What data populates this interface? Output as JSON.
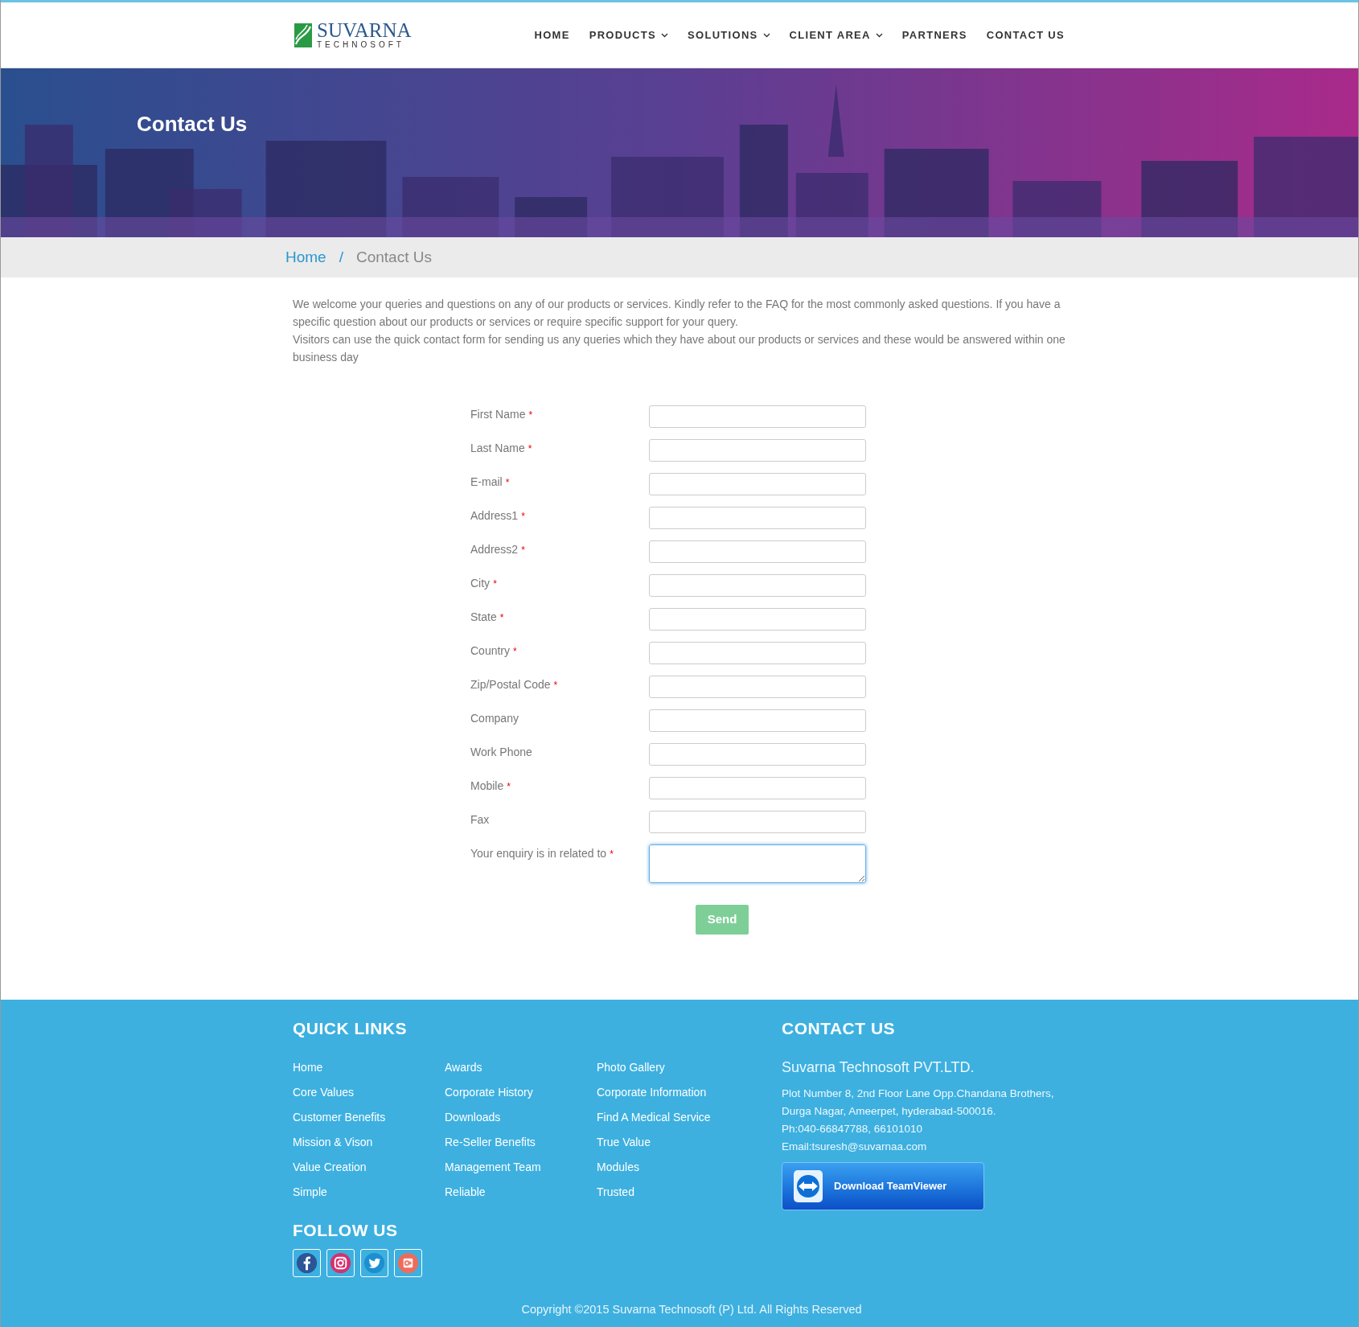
{
  "header": {
    "logo": {
      "name": "SUVARNA",
      "tagline": "TECHNOSOFT"
    },
    "nav": [
      {
        "label": "HOME",
        "dropdown": false
      },
      {
        "label": "PRODUCTS",
        "dropdown": true
      },
      {
        "label": "SOLUTIONS",
        "dropdown": true
      },
      {
        "label": "CLIENT AREA",
        "dropdown": true
      },
      {
        "label": "PARTNERS",
        "dropdown": false
      },
      {
        "label": "CONTACT US",
        "dropdown": false
      }
    ]
  },
  "hero": {
    "title": "Contact Us"
  },
  "breadcrumb": [
    {
      "label": "Home",
      "kind": "link"
    },
    {
      "label": "/",
      "kind": "separator"
    },
    {
      "label": "Contact Us",
      "kind": "current"
    }
  ],
  "intro": [
    "We welcome your queries and questions on any of our products or services. Kindly refer to the FAQ for the most commonly asked questions. If you have a specific question about our products or services or require specific support for your query.",
    "Visitors can use the quick contact form for sending us any queries which they have about our products or services and these would be answered within one business day"
  ],
  "form": {
    "fields": [
      {
        "label": "First Name",
        "required": true,
        "kind": "input",
        "focused": false
      },
      {
        "label": "Last Name",
        "required": true,
        "kind": "input",
        "focused": false
      },
      {
        "label": "E-mail",
        "required": true,
        "kind": "input",
        "focused": false
      },
      {
        "label": "Address1",
        "required": true,
        "kind": "input",
        "focused": false
      },
      {
        "label": "Address2",
        "required": true,
        "kind": "input",
        "focused": false
      },
      {
        "label": "City",
        "required": true,
        "kind": "input",
        "focused": false
      },
      {
        "label": "State",
        "required": true,
        "kind": "input",
        "focused": false
      },
      {
        "label": "Country",
        "required": true,
        "kind": "input",
        "focused": false
      },
      {
        "label": "Zip/Postal Code",
        "required": true,
        "kind": "input",
        "focused": false
      },
      {
        "label": "Company",
        "required": false,
        "kind": "input",
        "focused": false
      },
      {
        "label": "Work Phone",
        "required": false,
        "kind": "input",
        "focused": false
      },
      {
        "label": "Mobile",
        "required": true,
        "kind": "input",
        "focused": false
      },
      {
        "label": "Fax",
        "required": false,
        "kind": "input",
        "focused": false
      },
      {
        "label": "Your enquiry is in related to",
        "required": true,
        "kind": "textarea",
        "focused": true
      }
    ],
    "required_mark": "*",
    "submit": "Send"
  },
  "footer": {
    "quick_links": {
      "title": "QUICK LINKS",
      "columns": [
        [
          "Home",
          "Core Values",
          "Customer Benefits",
          "Mission & Vison",
          "Value Creation",
          "Simple"
        ],
        [
          "Awards",
          "Corporate History",
          "Downloads",
          "Re-Seller Benefits",
          "Management Team",
          "Reliable"
        ],
        [
          "Photo Gallery",
          "Corporate Information",
          "Find A Medical Service",
          "True Value",
          "Modules",
          "Trusted"
        ]
      ]
    },
    "follow": {
      "title": "FOLLOW US",
      "icons": [
        {
          "kind": "facebook"
        },
        {
          "kind": "instagram"
        },
        {
          "kind": "twitter"
        },
        {
          "kind": "googleplus"
        }
      ]
    },
    "contact": {
      "title": "CONTACT US",
      "company": "Suvarna Technosoft PVT.LTD.",
      "lines": [
        "Plot Number 8, 2nd Floor Lane Opp.Chandana Brothers,",
        "Durga Nagar, Ameerpet, hyderabad-500016.",
        "Ph:040-66847788, 66101010",
        "Email:tsuresh@suvarnaa.com"
      ],
      "button": "Download TeamViewer"
    },
    "copyright": "Copyright ©2015 Suvarna Technosoft (P) Ltd. All Rights Reserved"
  }
}
